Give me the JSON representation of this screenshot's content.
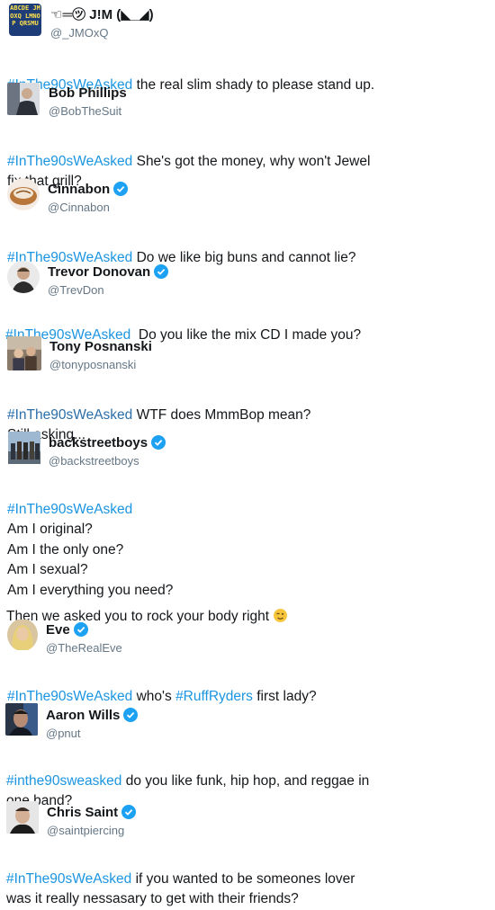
{
  "tweets": [
    {
      "name": "☜═㋡ J!M (◣_◢)",
      "handle": "@_JMOxQ",
      "verified": false,
      "avatar_text": "ABCDE JMOXQ LMNOP QRSMU",
      "hashtag": "#InThe90sWeAsked",
      "text": " the real slim shady to please stand up."
    },
    {
      "name": "Bob Phillips",
      "handle": "@BobTheSuit",
      "verified": false,
      "hashtag": "#InThe90sWeAsked",
      "text": " She's got the money, why won't Jewel\nfix that grill?"
    },
    {
      "name": "Cinnabon",
      "handle": "@Cinnabon",
      "verified": true,
      "hashtag": "#InThe90sWeAsked",
      "text": " Do we like big buns and cannot lie?"
    },
    {
      "name": "Trevor Donovan",
      "handle": "@TrevDon",
      "verified": true,
      "hashtag": "#InThe90sWeAsked",
      "text": "  Do you like the mix CD I made you?"
    },
    {
      "name": "Tony Posnanski",
      "handle": "@tonyposnanski",
      "verified": false,
      "hashtag": "#InThe90sWeAsked",
      "text": " WTF does MmmBop mean?\nStill asking..."
    },
    {
      "name": "backstreetboys",
      "handle": "@backstreetboys",
      "verified": true,
      "hashtag": "#InThe90sWeAsked",
      "text": "\nAm I original?\nAm I the only one?\nAm I sexual?\nAm I everything you need?",
      "extra": "Then we asked you to rock your body right"
    },
    {
      "name": "Eve",
      "handle": "@TheRealEve",
      "verified": true,
      "hashtag": "#InThe90sWeAsked",
      "text": " who's ",
      "hashtag2": "#RuffRyders",
      "text2": " first lady?"
    },
    {
      "name": "Aaron Wills",
      "handle": "@pnut",
      "verified": true,
      "hashtag": "#inthe90sweasked",
      "text": " do you like funk, hip hop, and reggae in\none band?"
    },
    {
      "name": "Chris Saint",
      "handle": "@saintpiercing",
      "verified": true,
      "hashtag": "#InThe90sWeAsked",
      "text": " if you wanted to be someones lover\nwas it really nessasary to get with their friends?"
    }
  ],
  "colors": {
    "hashtag": "#1b95e0",
    "handle": "#657786",
    "verified": "#1da1f2"
  }
}
